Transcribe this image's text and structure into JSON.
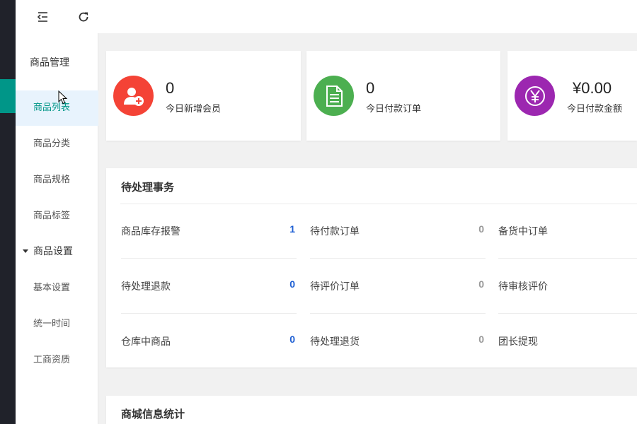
{
  "colors": {
    "accent": "#009688",
    "member_red": "#f44336",
    "order_green": "#4caf50",
    "amount_purple": "#9c27b0",
    "count_blue": "#1e5fd3",
    "count_gray": "#999999"
  },
  "topbar": {
    "icons": [
      "menu-fold-icon",
      "refresh-icon"
    ]
  },
  "sidebar": {
    "title": "商品管理",
    "items": [
      {
        "label": "商品列表",
        "active": true
      },
      {
        "label": "商品分类"
      },
      {
        "label": "商品规格"
      },
      {
        "label": "商品标签"
      }
    ],
    "group": {
      "label": "商品设置",
      "items": [
        {
          "label": "基本设置"
        },
        {
          "label": "统一时间"
        },
        {
          "label": "工商资质"
        }
      ]
    }
  },
  "stats": [
    {
      "value": "0",
      "label": "今日新增会员",
      "icon": "add-user-icon"
    },
    {
      "value": "0",
      "label": "今日付款订单",
      "icon": "document-icon"
    },
    {
      "value": "¥0.00",
      "label": "今日付款金额",
      "icon": "yen-icon"
    }
  ],
  "pending": {
    "title": "待处理事务",
    "cells": [
      {
        "label": "商品库存报警",
        "value": "1"
      },
      {
        "label": "待付款订单",
        "value": "0"
      },
      {
        "label": "备货中订单",
        "value": ""
      },
      {
        "label": "待处理退款",
        "value": "0"
      },
      {
        "label": "待评价订单",
        "value": "0"
      },
      {
        "label": "待审核评价",
        "value": ""
      },
      {
        "label": "仓库中商品",
        "value": "0"
      },
      {
        "label": "待处理退货",
        "value": "0"
      },
      {
        "label": "团长提现",
        "value": ""
      }
    ]
  },
  "mall_stats": {
    "title": "商城信息统计"
  }
}
